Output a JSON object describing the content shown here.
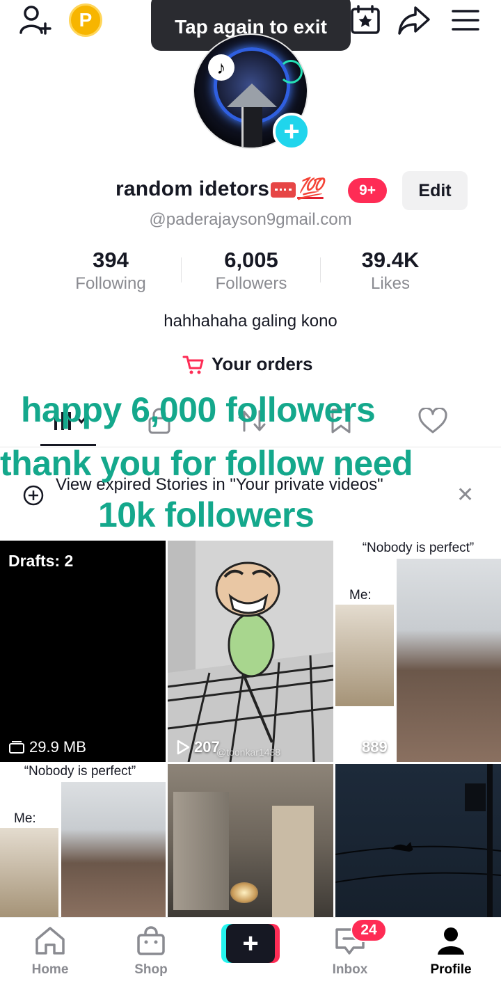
{
  "toast": {
    "text": "Tap again to exit"
  },
  "top_bar": {
    "coin_label": "P",
    "icons": [
      "add-friend-icon",
      "coin-icon",
      "calendar-star-icon",
      "share-icon",
      "menu-icon"
    ]
  },
  "profile": {
    "display_name": "random idetors",
    "hundred_emoji": "💯",
    "notification_badge": "9+",
    "edit_label": "Edit",
    "handle": "@paderajayson9gmail.com",
    "stats": [
      {
        "value": "394",
        "label": "Following"
      },
      {
        "value": "6,005",
        "label": "Followers"
      },
      {
        "value": "39.4K",
        "label": "Likes"
      }
    ],
    "bio": "hahhahaha galing kono",
    "orders_label": "Your orders"
  },
  "banner": {
    "text": "View expired Stories in \"Your private videos\""
  },
  "overlay_caption": {
    "line1": "happy 6,000 followers",
    "line2": "thank you for follow need",
    "line3": "10k followers"
  },
  "grid": {
    "drafts_label": "Drafts: 2",
    "drafts_size": "29.9 MB",
    "video2_views": "207",
    "video2_watermark": "@toonkar1438",
    "video3_caption": "“Nobody is perfect”",
    "video3_me": "Me:",
    "video3_views": "889",
    "video4_caption": "“Nobody is perfect”",
    "video4_me": "Me:"
  },
  "bottom_nav": {
    "home": "Home",
    "shop": "Shop",
    "create": "+",
    "inbox": "Inbox",
    "inbox_badge": "24",
    "profile": "Profile"
  },
  "colors": {
    "accent_pink": "#fe2c55",
    "accent_cyan": "#25f4ee",
    "caption_green": "#14a88c",
    "coin_gold": "#f7b500"
  }
}
